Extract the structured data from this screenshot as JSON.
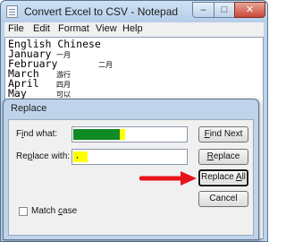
{
  "window": {
    "title": "Convert Excel to CSV - Notepad",
    "controls": {
      "minimize": "–",
      "maximize": "□",
      "close": "✕"
    }
  },
  "menu": {
    "items": [
      "File",
      "Edit",
      "Format",
      "View",
      "Help"
    ]
  },
  "editor": {
    "lines": [
      "English Chinese",
      "January",
      "February",
      "March",
      "April",
      "May"
    ],
    "chinese": [
      "一月",
      "二月",
      "游行",
      "四月",
      "可以"
    ]
  },
  "dialog": {
    "title": "Replace",
    "find_label_pre": "F",
    "find_label_u": "i",
    "find_label_post": "nd what:",
    "replace_label_pre": "Re",
    "replace_label_u": "p",
    "replace_label_post": "lace with:",
    "replace_value": ",",
    "buttons": {
      "find_next_u": "F",
      "find_next_rest": "ind Next",
      "replace_u": "R",
      "replace_rest": "eplace",
      "replace_all_pre": "Replace ",
      "replace_all_u": "A",
      "replace_all_post": "ll",
      "cancel": "Cancel"
    },
    "match_case_pre": "Match ",
    "match_case_u": "c",
    "match_case_post": "ase"
  },
  "colors": {
    "highlight_green": "#0f8a24",
    "highlight_yellow": "#ffff00",
    "arrow_red": "#e8141c"
  }
}
